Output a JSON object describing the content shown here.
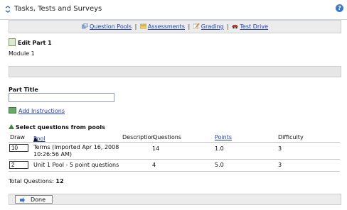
{
  "header": {
    "title": "Tasks, Tests and Surveys",
    "help_symbol": "?"
  },
  "toolbar": {
    "links": [
      {
        "label": "Question Pools",
        "icon": "question-pools-icon"
      },
      {
        "label": "Assessments",
        "icon": "assessments-icon"
      },
      {
        "label": "Grading",
        "icon": "grading-icon"
      },
      {
        "label": "Test Drive",
        "icon": "test-drive-icon"
      }
    ],
    "separator": "|"
  },
  "edit": {
    "title": "Edit Part 1",
    "module": "Module 1"
  },
  "part_title": {
    "label": "Part Title",
    "value": ""
  },
  "add_instructions": {
    "label": "Add Instructions"
  },
  "pools": {
    "title": "Select questions from pools",
    "columns": {
      "draw": "Draw",
      "pool": "Pool",
      "pool_sort": "▲",
      "description": "Description",
      "questions": "Questions",
      "points": "Points",
      "difficulty": "Difficulty"
    },
    "rows": [
      {
        "draw": "10",
        "pool_line1": "Terms (Imported Apr 16, 2008",
        "pool_line2": "10:26:56 AM)",
        "description": "",
        "questions": "14",
        "points": "1.0",
        "difficulty": "3"
      },
      {
        "draw": "2",
        "pool_line1": "Unit 1 Pool - 5 point questions",
        "pool_line2": "",
        "description": "",
        "questions": "4",
        "points": "5.0",
        "difficulty": "3"
      }
    ]
  },
  "total": {
    "label": "Total Questions:",
    "value": "12"
  },
  "footer": {
    "done_label": "Done"
  }
}
